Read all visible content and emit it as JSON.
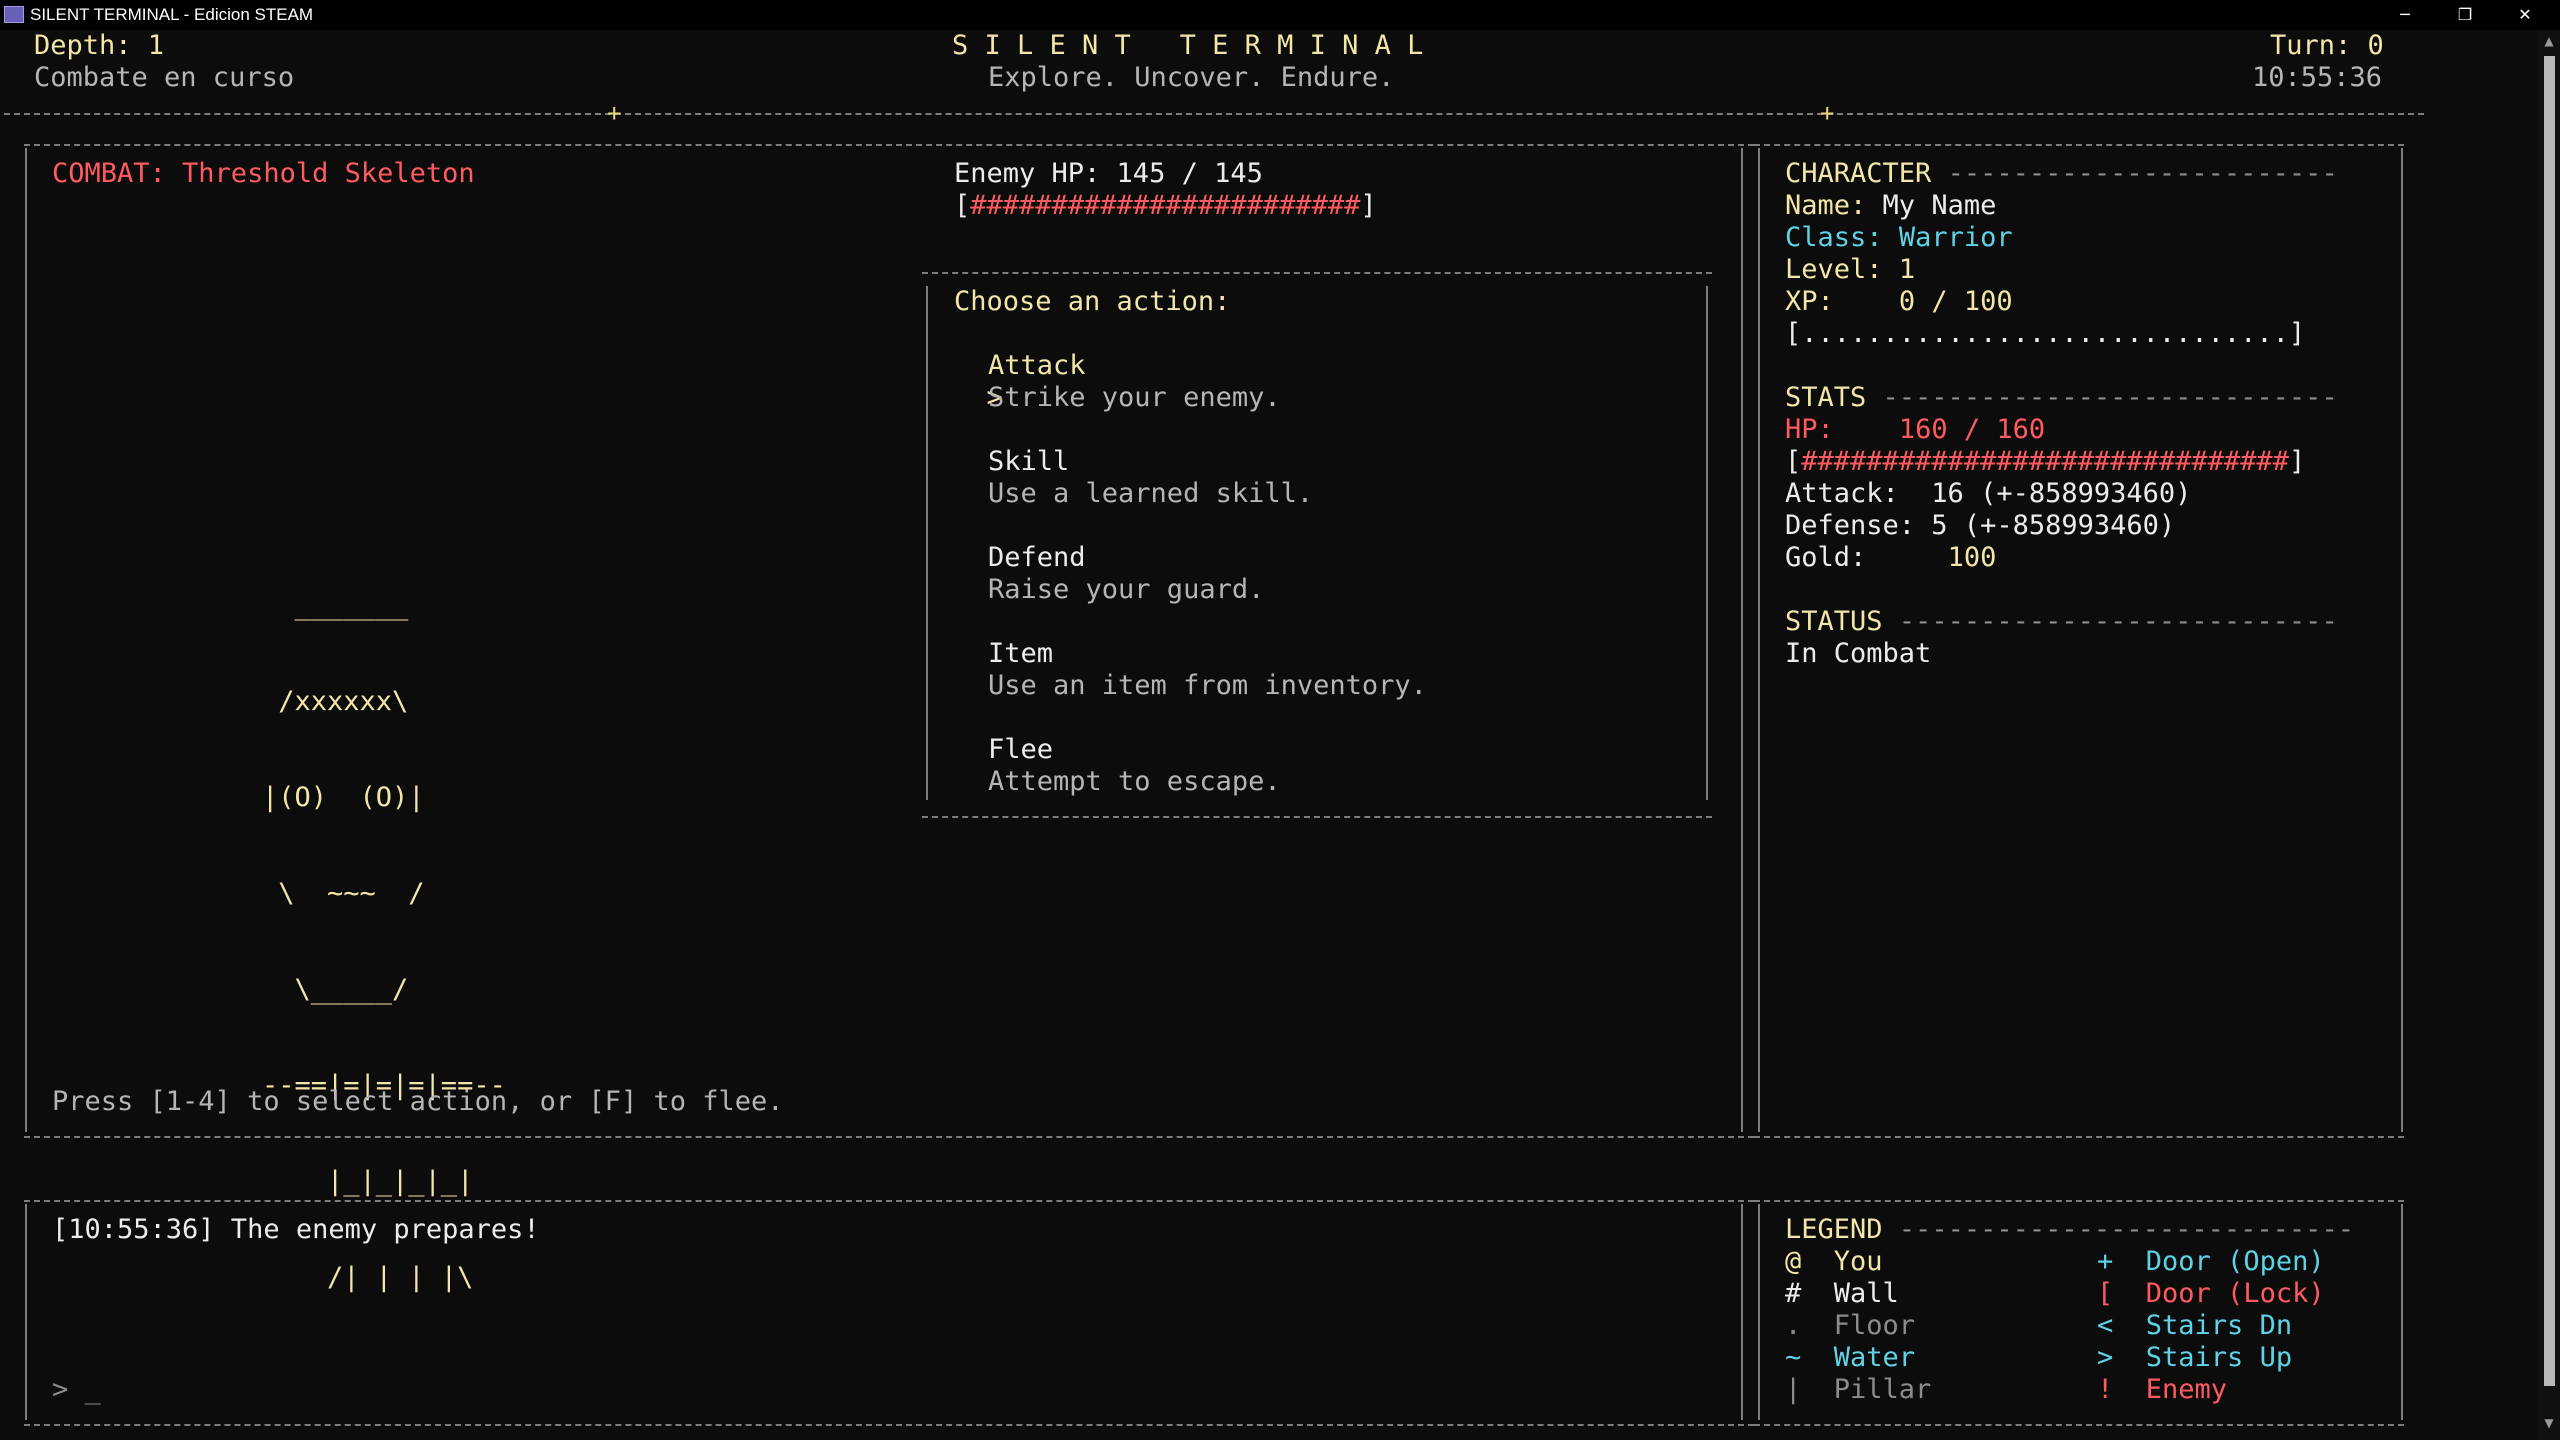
{
  "window": {
    "title": "SILENT TERMINAL - Edicion STEAM",
    "minimize_label": "─",
    "restore_label": "❐",
    "close_label": "✕"
  },
  "header": {
    "depth": "Depth: 1",
    "status": "Combate en curso",
    "title": "S I L E N T   T E R M I N A L",
    "subtitle": "Explore. Uncover. Endure.",
    "turn": "Turn: 0",
    "clock": "10:55:36"
  },
  "combat": {
    "title": "COMBAT: Threshold Skeleton",
    "enemy_hp": "Enemy HP: 145 / 145",
    "enemy_hp_bar_open": "[",
    "enemy_hp_bar_fill": "########################",
    "enemy_hp_bar_close": "]",
    "enemy_hp_fraction": 1.0,
    "sprite_lines": [
      "  _______",
      " /xxxxxx\\",
      "|(O)  (O)|",
      " \\  ~~~  /",
      "  \\_____/",
      "--==|=|=|=|==--",
      "    |_|_|_|_|",
      "    /| | | |\\"
    ],
    "hint": "Press [1-4] to select action, or [F] to flee."
  },
  "actions": {
    "prompt": "Choose an action:",
    "cursor": ">",
    "items": [
      {
        "label": "Attack",
        "desc": "Strike your enemy.",
        "selected": true
      },
      {
        "label": "Skill",
        "desc": "Use a learned skill.",
        "selected": false
      },
      {
        "label": "Defend",
        "desc": "Raise your guard.",
        "selected": false
      },
      {
        "label": "Item",
        "desc": "Use an item from inventory.",
        "selected": false
      },
      {
        "label": "Flee",
        "desc": "Attempt to escape.",
        "selected": false
      }
    ]
  },
  "character": {
    "heading": "CHARACTER",
    "name_label": "Name:",
    "name_value": "My Name",
    "class_label": "Class:",
    "class_value": "Warrior",
    "level_label": "Level:",
    "level_value": "1",
    "xp_label": "XP:",
    "xp_value": "0 / 100",
    "xp_bar": "[..............................]",
    "xp_fraction": 0.0
  },
  "stats": {
    "heading": "STATS",
    "hp_label": "HP:",
    "hp_value": "160 / 160",
    "hp_bar_open": "[",
    "hp_bar_fill": "##############################",
    "hp_bar_close": "]",
    "hp_fraction": 1.0,
    "attack": "Attack:  16 (+-858993460)",
    "defense": "Defense: 5 (+-858993460)",
    "gold_label": "Gold:",
    "gold_value": "100"
  },
  "status": {
    "heading": "STATUS",
    "value": "In Combat"
  },
  "log": {
    "message": "[10:55:36] The enemy prepares!",
    "prompt": "> _"
  },
  "legend": {
    "heading": "LEGEND",
    "left": [
      {
        "symbol": "@",
        "label": "You",
        "color": "#f2e6a8"
      },
      {
        "symbol": "#",
        "label": "Wall",
        "color": "#ececec"
      },
      {
        "symbol": ".",
        "label": "Floor",
        "color": "#8c8c8c"
      },
      {
        "symbol": "~",
        "label": "Water",
        "color": "#5fd3e6"
      },
      {
        "symbol": "|",
        "label": "Pillar",
        "color": "#8c8c8c"
      }
    ],
    "right": [
      {
        "symbol": "+",
        "label": "Door (Open)",
        "color": "#5fd3e6"
      },
      {
        "symbol": "[",
        "label": "Door (Lock)",
        "color": "#ff5a5f"
      },
      {
        "symbol": "<",
        "label": "Stairs Dn",
        "color": "#5fd3e6"
      },
      {
        "symbol": ">",
        "label": "Stairs Up",
        "color": "#5fd3e6"
      },
      {
        "symbol": "!",
        "label": "Enemy",
        "color": "#ff5a5f"
      }
    ]
  }
}
